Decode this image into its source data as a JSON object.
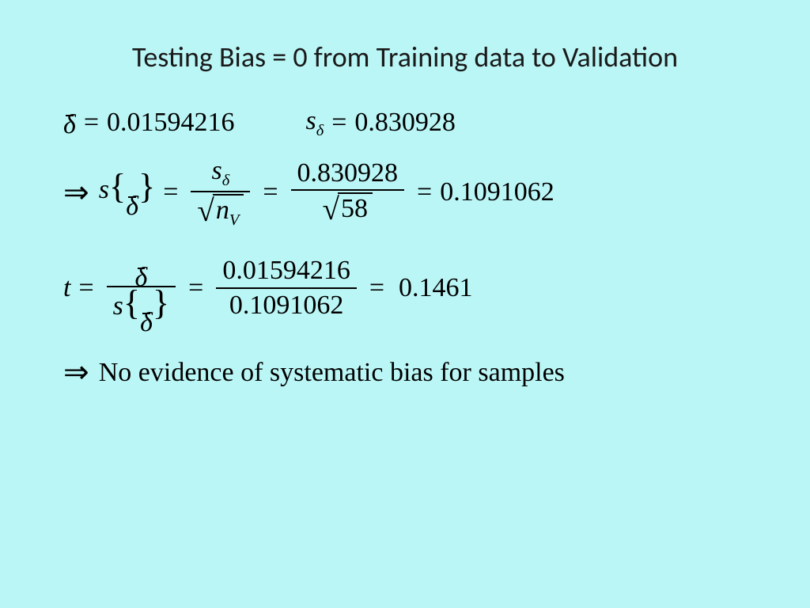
{
  "title": "Testing Bias = 0 from Training data to Validation",
  "symbols": {
    "delta": "δ",
    "s": "s",
    "t": "t",
    "n": "n",
    "V": "V",
    "arrow": "⇒",
    "eq": "=",
    "sqrt": "√"
  },
  "values": {
    "delta_bar": "0.01594216",
    "s_delta": "0.830928",
    "n_V": "58",
    "s_delta_bar": "0.1091062",
    "t_num": "0.01594216",
    "t_den": "0.1091062",
    "t_value": "0.1461"
  },
  "conclusion": "No evidence of systematic bias for samples"
}
